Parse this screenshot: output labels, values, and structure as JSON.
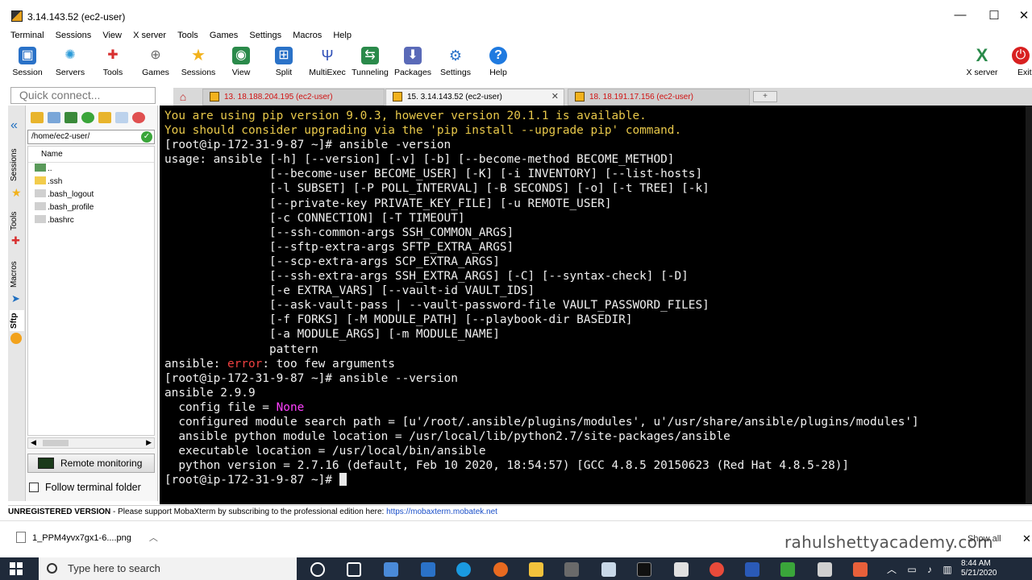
{
  "window": {
    "title": "3.14.143.52 (ec2-user)",
    "minimize": "—",
    "maximize": "☐",
    "close": "✕"
  },
  "menu": [
    "Terminal",
    "Sessions",
    "View",
    "X server",
    "Tools",
    "Games",
    "Settings",
    "Macros",
    "Help"
  ],
  "toolbar": {
    "items": [
      {
        "label": "Session",
        "icon": "session-icon",
        "color": "#2a72c8"
      },
      {
        "label": "Servers",
        "icon": "servers-icon",
        "color": "#2a9ad8"
      },
      {
        "label": "Tools",
        "icon": "tools-icon",
        "color": "#d83030"
      },
      {
        "label": "Games",
        "icon": "games-icon",
        "color": "#6a6a6a"
      },
      {
        "label": "Sessions",
        "icon": "star-icon",
        "color": "#f2b21c"
      },
      {
        "label": "View",
        "icon": "view-icon",
        "color": "#2a8a4a"
      },
      {
        "label": "Split",
        "icon": "split-icon",
        "color": "#2a72c8"
      },
      {
        "label": "MultiExec",
        "icon": "multiexec-icon",
        "color": "#3050b8"
      },
      {
        "label": "Tunneling",
        "icon": "tunneling-icon",
        "color": "#2a8a4a"
      },
      {
        "label": "Packages",
        "icon": "packages-icon",
        "color": "#5a6ab8"
      },
      {
        "label": "Settings",
        "icon": "gear-icon",
        "color": "#2a72c8"
      },
      {
        "label": "Help",
        "icon": "help-icon",
        "color": "#1f7ae0"
      }
    ],
    "xserver_label": "X server",
    "exit_label": "Exit"
  },
  "quick_connect": {
    "placeholder": "Quick connect..."
  },
  "tabs": [
    {
      "label": "13. 18.188.204.195 (ec2-user)",
      "active": false
    },
    {
      "label": "15. 3.14.143.52 (ec2-user)",
      "active": true
    },
    {
      "label": "18. 18.191.17.156 (ec2-user)",
      "active": false
    }
  ],
  "sidebar": {
    "vertical_tabs": [
      "Sessions",
      "Tools",
      "Macros",
      "Sftp"
    ],
    "path": "/home/ec2-user/",
    "column_name": "Name",
    "files": [
      {
        "name": "..",
        "type": "parent"
      },
      {
        "name": ".ssh",
        "type": "folder"
      },
      {
        "name": ".bash_logout",
        "type": "file"
      },
      {
        "name": ".bash_profile",
        "type": "file"
      },
      {
        "name": ".bashrc",
        "type": "file"
      }
    ],
    "remote_monitoring": "Remote monitoring",
    "follow_terminal": "Follow terminal folder"
  },
  "terminal": {
    "lines": [
      [
        {
          "t": "You are using pip version 9.0.3, however version 20.1.1 is available.",
          "c": "yel"
        }
      ],
      [
        {
          "t": "You should consider upgrading via the 'pip install --upgrade pip' command.",
          "c": "yel"
        }
      ],
      [
        {
          "t": "[root@ip-172-31-9-87 ~]# ansible -version",
          "c": ""
        }
      ],
      [
        {
          "t": "usage: ansible [-h] [--version] [-v] [-b] [--become-method BECOME_METHOD]",
          "c": ""
        }
      ],
      [
        {
          "t": "               [--become-user BECOME_USER] [-K] [-i INVENTORY] [--list-hosts]",
          "c": ""
        }
      ],
      [
        {
          "t": "               [-l SUBSET] [-P POLL_INTERVAL] [-B SECONDS] [-o] [-t TREE] [-k]",
          "c": ""
        }
      ],
      [
        {
          "t": "               [--private-key PRIVATE_KEY_FILE] [-u REMOTE_USER]",
          "c": ""
        }
      ],
      [
        {
          "t": "               [-c CONNECTION] [-T TIMEOUT]",
          "c": ""
        }
      ],
      [
        {
          "t": "               [--ssh-common-args SSH_COMMON_ARGS]",
          "c": ""
        }
      ],
      [
        {
          "t": "               [--sftp-extra-args SFTP_EXTRA_ARGS]",
          "c": ""
        }
      ],
      [
        {
          "t": "               [--scp-extra-args SCP_EXTRA_ARGS]",
          "c": ""
        }
      ],
      [
        {
          "t": "               [--ssh-extra-args SSH_EXTRA_ARGS] [-C] [--syntax-check] [-D]",
          "c": ""
        }
      ],
      [
        {
          "t": "               [-e EXTRA_VARS] [--vault-id VAULT_IDS]",
          "c": ""
        }
      ],
      [
        {
          "t": "               [--ask-vault-pass | --vault-password-file VAULT_PASSWORD_FILES]",
          "c": ""
        }
      ],
      [
        {
          "t": "               [-f FORKS] [-M MODULE_PATH] [--playbook-dir BASEDIR]",
          "c": ""
        }
      ],
      [
        {
          "t": "               [-a MODULE_ARGS] [-m MODULE_NAME]",
          "c": ""
        }
      ],
      [
        {
          "t": "               pattern",
          "c": ""
        }
      ],
      [
        {
          "t": "ansible: ",
          "c": ""
        },
        {
          "t": "error",
          "c": "red"
        },
        {
          "t": ": too few arguments",
          "c": ""
        }
      ],
      [
        {
          "t": "[root@ip-172-31-9-87 ~]# ansible --version",
          "c": ""
        }
      ],
      [
        {
          "t": "ansible 2.9.9",
          "c": ""
        }
      ],
      [
        {
          "t": "  config file = ",
          "c": ""
        },
        {
          "t": "None",
          "c": "mag"
        }
      ],
      [
        {
          "t": "  configured module search path = [u'/root/.ansible/plugins/modules', u'/usr/share/ansible/plugins/modules']",
          "c": ""
        }
      ],
      [
        {
          "t": "  ansible python module location = /usr/local/lib/python2.7/site-packages/ansible",
          "c": ""
        }
      ],
      [
        {
          "t": "  executable location = /usr/local/bin/ansible",
          "c": ""
        }
      ],
      [
        {
          "t": "  python version = 2.7.16 (default, Feb 10 2020, 18:54:57) [GCC 4.8.5 20150623 (Red Hat 4.8.5-28)]",
          "c": ""
        }
      ],
      [
        {
          "t": "[root@ip-172-31-9-87 ~]# ",
          "c": ""
        }
      ]
    ]
  },
  "status": {
    "unregistered": "UNREGISTERED VERSION",
    "message": " -  Please support MobaXterm by subscribing to the professional edition here: ",
    "link": "https://mobaxterm.mobatek.net"
  },
  "download_bar": {
    "file": "1_PPM4yvx7gx1-6....png",
    "show_all": "Show all",
    "watermark": "rahulshettyacademy.com"
  },
  "taskbar": {
    "search_placeholder": "Type here to search",
    "time": "8:44 AM",
    "date": "5/21/2020"
  }
}
